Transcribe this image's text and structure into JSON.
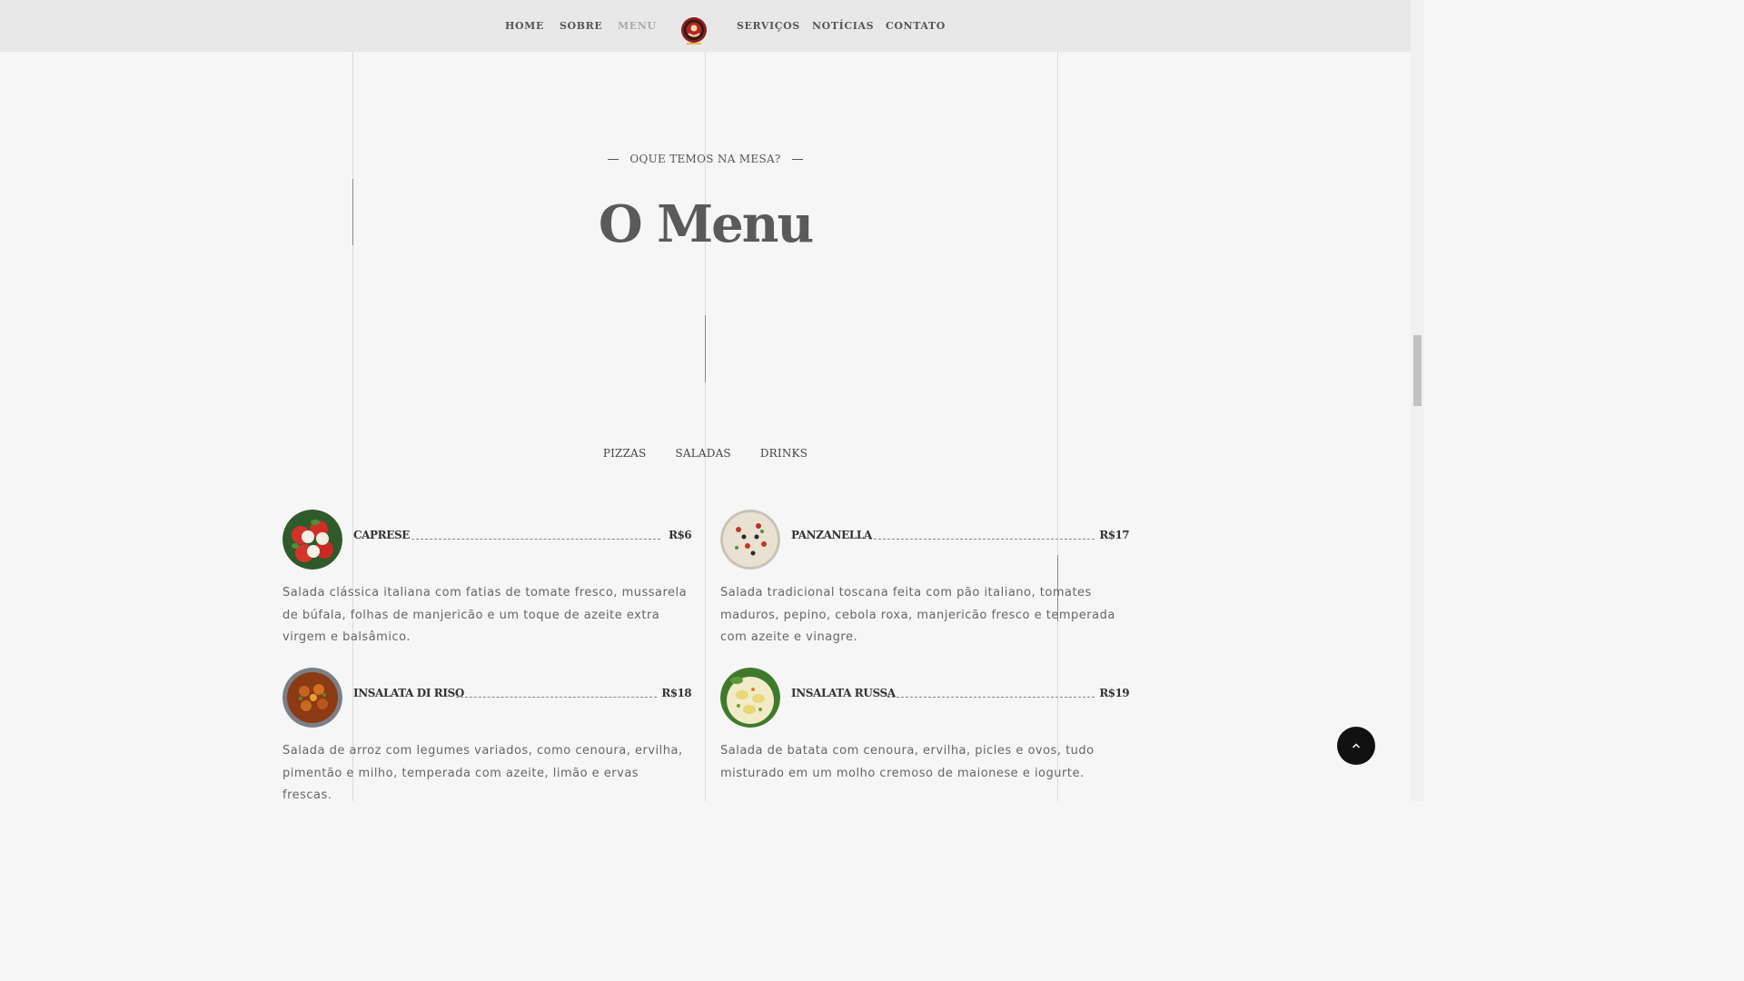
{
  "nav": {
    "left": [
      "HOME",
      "SOBRE",
      "MENU"
    ],
    "right": [
      "SERVIÇOS",
      "NOTÍCIAS",
      "CONTATO"
    ],
    "active": "MENU",
    "logo_icon": "restaurant-logo-icon"
  },
  "section": {
    "eyebrow": "OQUE TEMOS NA MESA?",
    "title": "O Menu"
  },
  "tabs": [
    "PIZZAS",
    "SALADAS",
    "DRINKS"
  ],
  "items": [
    {
      "name": "CAPRESE",
      "price": "R$6",
      "description": "Salada clássica italiana com fatias de tomate fresco, mussarela de búfala, folhas de manjericão e um toque de azeite extra virgem e balsâmico.",
      "image_icon": "caprese-salad-image"
    },
    {
      "name": "PANZANELLA",
      "price": "R$17",
      "description": "Salada tradicional toscana feita com pão italiano, tomates maduros, pepino, cebola roxa, manjericão fresco e temperada com azeite e vinagre.",
      "image_icon": "panzanella-salad-image"
    },
    {
      "name": "INSALATA DI RISO",
      "price": "R$18",
      "description": "Salada de arroz com legumes variados, como cenoura, ervilha, pimentão e milho, temperada com azeite, limão e ervas frescas.",
      "image_icon": "rice-salad-image"
    },
    {
      "name": "INSALATA RUSSA",
      "price": "R$19",
      "description": "Salada de batata com cenoura, ervilha, picles e ovos, tudo misturado em um molho cremoso de maionese e iogurte.",
      "image_icon": "russian-salad-image"
    }
  ],
  "colors": {
    "background": "#f6f6f6",
    "nav_background": "#e8e8e8",
    "text": "#555555",
    "active_nav": "#aaaaaa",
    "back_to_top": "#111111"
  },
  "back_to_top_icon": "chevron-up-icon"
}
